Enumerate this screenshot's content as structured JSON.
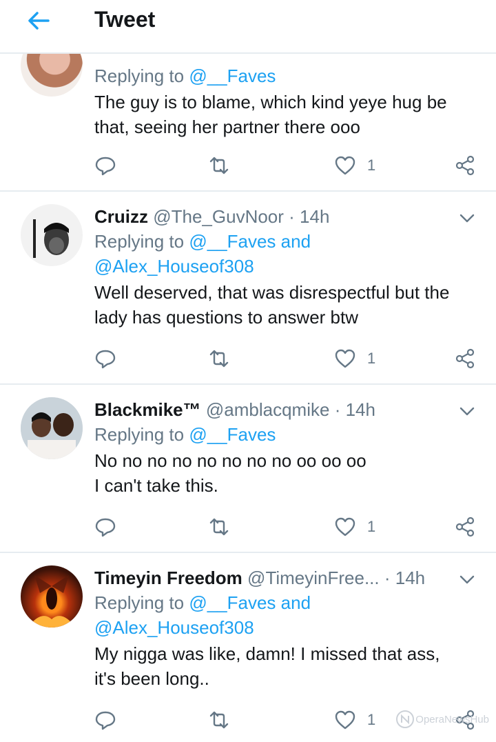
{
  "header": {
    "title": "Tweet",
    "back_icon": "arrow-left-icon",
    "accent": "#1da1f2"
  },
  "tweets": [
    {
      "replying_prefix": "Replying to",
      "replying_handles": "@__Faves",
      "text_lines": [
        "The guy is to blame, which kind yeye hug be",
        "that,  seeing her partner there ooo"
      ],
      "likes": "1"
    },
    {
      "name": "Cruizz",
      "handle": "@The_GuvNoor",
      "time": "· 14h",
      "replying_prefix": "Replying to",
      "replying_handles": "@__Faves and",
      "replying_line2": "@Alex_Houseof308",
      "text_lines": [
        "Well deserved, that was disrespectful but the",
        "lady has questions to answer btw"
      ],
      "likes": "1"
    },
    {
      "name": "Blackmike™",
      "handle": "@amblacqmike",
      "time": "· 14h",
      "replying_prefix": "Replying to",
      "replying_handles": "@__Faves",
      "text_lines": [
        "No no no no no no no no oo oo oo",
        "I can't take this."
      ],
      "likes": "1"
    },
    {
      "name": "Timeyin Freedom",
      "handle": "@TimeyinFree...",
      "time": "· 14h",
      "replying_prefix": "Replying to",
      "replying_handles": "@__Faves and",
      "replying_line2": "@Alex_Houseof308",
      "text_lines": [
        "My nigga was like, damn! I missed that ass,",
        "it's been long.."
      ],
      "likes": "1"
    }
  ],
  "watermark": "OperaNewsHub"
}
